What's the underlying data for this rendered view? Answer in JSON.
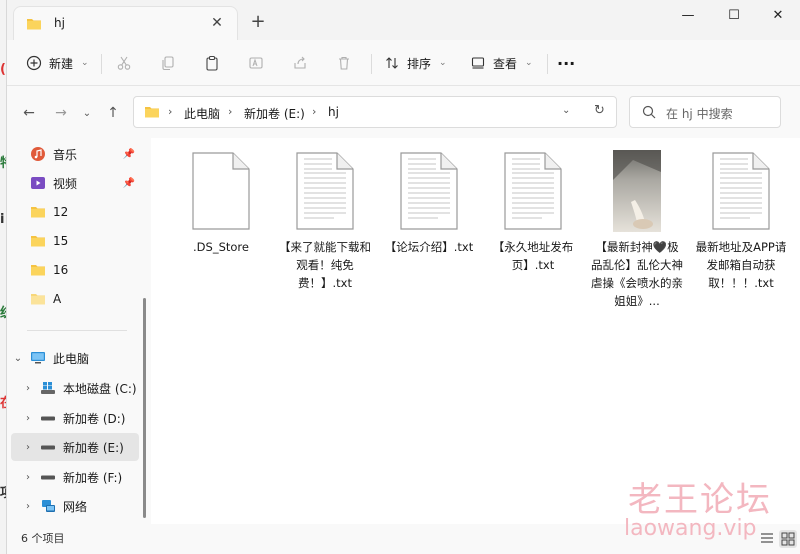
{
  "window": {
    "tab_title": "hj",
    "new_tab": "+",
    "minimize": "—",
    "maximize": "☐",
    "close": "✕"
  },
  "toolbar": {
    "new_label": "新建",
    "sort_label": "排序",
    "view_label": "查看",
    "more": "···"
  },
  "address": {
    "segments": [
      "此电脑",
      "新加卷 (E:)",
      "hj"
    ],
    "search_placeholder": "在 hj 中搜索"
  },
  "sidebar": {
    "quick_access": [
      {
        "label": "音乐",
        "icon": "music-folder-icon",
        "pinned": true
      },
      {
        "label": "视频",
        "icon": "video-folder-icon",
        "pinned": true
      },
      {
        "label": "12",
        "icon": "folder-icon"
      },
      {
        "label": "15",
        "icon": "folder-icon"
      },
      {
        "label": "16",
        "icon": "folder-icon"
      },
      {
        "label": "A",
        "icon": "folder-icon"
      }
    ],
    "this_pc": "此电脑",
    "drives": [
      {
        "label": "本地磁盘 (C:)",
        "icon": "windows-drive-icon"
      },
      {
        "label": "新加卷 (D:)",
        "icon": "drive-icon"
      },
      {
        "label": "新加卷 (E:)",
        "icon": "drive-icon",
        "selected": true
      },
      {
        "label": "新加卷 (F:)",
        "icon": "drive-icon"
      }
    ],
    "network": "网络"
  },
  "files": [
    {
      "name": ".DS_Store",
      "type": "blank"
    },
    {
      "name": "【来了就能下载和观看！纯免费！】.txt",
      "type": "text"
    },
    {
      "name": "【论坛介绍】.txt",
      "type": "text"
    },
    {
      "name": "【永久地址发布页】.txt",
      "type": "text"
    },
    {
      "name": "【最新封神🖤极品乱伦】乱伦大神虐操《会喷水的亲姐姐》...",
      "type": "video"
    },
    {
      "name": "最新地址及APP请发邮箱自动获取！！！.txt",
      "type": "text"
    }
  ],
  "status": {
    "count": "6 个项目"
  },
  "watermark": {
    "line1": "老王论坛",
    "line2": "laowang.vip"
  },
  "colors": {
    "folder": "#f5c342",
    "accent": "#0a64c8",
    "watermark": "#f3b7c0"
  }
}
